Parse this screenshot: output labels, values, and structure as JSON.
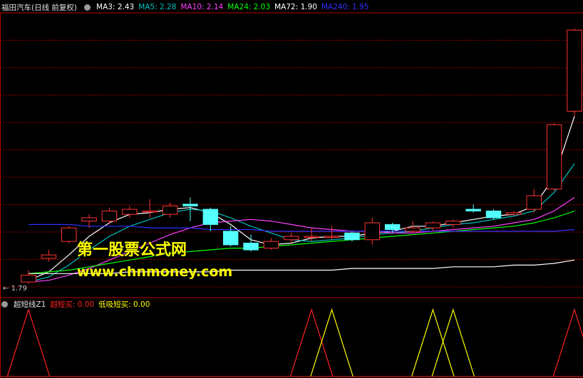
{
  "main_legend": {
    "title": "福田汽车(日线 前复权)",
    "items": [
      {
        "label": "MA3: 2.43",
        "color": "#ffffff"
      },
      {
        "label": "MA5: 2.28",
        "color": "#00bfbf"
      },
      {
        "label": "MA10: 2.14",
        "color": "#ff40ff"
      },
      {
        "label": "MA24: 2.03",
        "color": "#00ff00"
      },
      {
        "label": "MA72: 1.90",
        "color": "#ffffff"
      },
      {
        "label": "MA240: 1.95",
        "color": "#3030ff"
      }
    ]
  },
  "sub_legend": {
    "title": "超短线Z1",
    "items": [
      {
        "label": "超短买: 0.00",
        "color": "#ff2020"
      },
      {
        "label": "低吸短买: 0.00",
        "color": "#ffff00"
      }
    ]
  },
  "watermark": {
    "line1": "第一股票公式网",
    "line2": "www.chnmoney.com"
  },
  "low_marker": "1.79",
  "chart_data": {
    "type": "candlestick",
    "candles": [
      {
        "o": 1.8,
        "c": 1.84,
        "h": 1.87,
        "l": 1.79
      },
      {
        "o": 1.94,
        "c": 1.96,
        "h": 1.99,
        "l": 1.92
      },
      {
        "o": 2.04,
        "c": 2.12,
        "h": 2.13,
        "l": 2.03
      },
      {
        "o": 2.16,
        "c": 2.18,
        "h": 2.2,
        "l": 2.12
      },
      {
        "o": 2.16,
        "c": 2.22,
        "h": 2.24,
        "l": 2.14
      },
      {
        "o": 2.2,
        "c": 2.23,
        "h": 2.25,
        "l": 2.18
      },
      {
        "o": 2.22,
        "c": 2.22,
        "h": 2.29,
        "l": 2.18
      },
      {
        "o": 2.2,
        "c": 2.25,
        "h": 2.27,
        "l": 2.18
      },
      {
        "o": 2.26,
        "c": 2.25,
        "h": 2.3,
        "l": 2.16
      },
      {
        "o": 2.23,
        "c": 2.14,
        "h": 2.24,
        "l": 2.1
      },
      {
        "o": 2.1,
        "c": 2.02,
        "h": 2.13,
        "l": 2.01
      },
      {
        "o": 2.03,
        "c": 1.99,
        "h": 2.08,
        "l": 1.98
      },
      {
        "o": 2.0,
        "c": 2.04,
        "h": 2.06,
        "l": 1.99
      },
      {
        "o": 2.05,
        "c": 2.07,
        "h": 2.09,
        "l": 2.03
      },
      {
        "o": 2.07,
        "c": 2.07,
        "h": 2.12,
        "l": 2.04
      },
      {
        "o": 2.07,
        "c": 2.07,
        "h": 2.13,
        "l": 2.05
      },
      {
        "o": 2.09,
        "c": 2.05,
        "h": 2.1,
        "l": 2.04
      },
      {
        "o": 2.05,
        "c": 2.15,
        "h": 2.18,
        "l": 2.02
      },
      {
        "o": 2.14,
        "c": 2.11,
        "h": 2.15,
        "l": 2.09
      },
      {
        "o": 2.1,
        "c": 2.12,
        "h": 2.16,
        "l": 2.09
      },
      {
        "o": 2.12,
        "c": 2.15,
        "h": 2.16,
        "l": 2.1
      },
      {
        "o": 2.14,
        "c": 2.16,
        "h": 2.17,
        "l": 2.12
      },
      {
        "o": 2.23,
        "c": 2.22,
        "h": 2.26,
        "l": 2.21
      },
      {
        "o": 2.22,
        "c": 2.18,
        "h": 2.23,
        "l": 2.17
      },
      {
        "o": 2.2,
        "c": 2.21,
        "h": 2.22,
        "l": 2.19
      },
      {
        "o": 2.23,
        "c": 2.31,
        "h": 2.35,
        "l": 2.21
      },
      {
        "o": 2.35,
        "c": 2.73,
        "h": 2.74,
        "l": 2.34
      },
      {
        "o": 2.81,
        "c": 3.29,
        "h": 3.3,
        "l": 2.78
      }
    ],
    "ma": [
      {
        "name": "MA3",
        "color": "#ffffff",
        "values": [
          1.81,
          1.86,
          1.96,
          2.07,
          2.15,
          2.2,
          2.21,
          2.23,
          2.24,
          2.21,
          2.14,
          2.05,
          2.02,
          2.03,
          2.06,
          2.07,
          2.07,
          2.09,
          2.1,
          2.13,
          2.13,
          2.15,
          2.17,
          2.19,
          2.2,
          2.25,
          2.42,
          2.78
        ]
      },
      {
        "name": "MA5",
        "color": "#00bfbf",
        "values": [
          1.8,
          1.83,
          1.9,
          1.99,
          2.07,
          2.13,
          2.17,
          2.21,
          2.23,
          2.22,
          2.18,
          2.13,
          2.09,
          2.05,
          2.04,
          2.05,
          2.06,
          2.08,
          2.09,
          2.1,
          2.12,
          2.14,
          2.15,
          2.17,
          2.19,
          2.22,
          2.33,
          2.5
        ]
      },
      {
        "name": "MA10",
        "color": "#ff40ff",
        "values": [
          1.8,
          1.81,
          1.84,
          1.88,
          1.93,
          1.98,
          2.03,
          2.08,
          2.12,
          2.15,
          2.16,
          2.17,
          2.16,
          2.14,
          2.12,
          2.11,
          2.1,
          2.1,
          2.09,
          2.09,
          2.1,
          2.11,
          2.12,
          2.13,
          2.15,
          2.17,
          2.22,
          2.3
        ]
      },
      {
        "name": "MA24",
        "color": "#00ff00",
        "values": [
          1.85,
          1.86,
          1.87,
          1.89,
          1.91,
          1.93,
          1.95,
          1.97,
          1.98,
          1.99,
          2.0,
          2.0,
          2.01,
          2.02,
          2.03,
          2.04,
          2.05,
          2.06,
          2.07,
          2.08,
          2.09,
          2.1,
          2.11,
          2.12,
          2.13,
          2.15,
          2.18,
          2.22
        ]
      },
      {
        "name": "MA72",
        "color": "#ffffff",
        "values": [
          1.85,
          1.85,
          1.85,
          1.85,
          1.85,
          1.86,
          1.86,
          1.86,
          1.86,
          1.86,
          1.87,
          1.87,
          1.87,
          1.87,
          1.87,
          1.87,
          1.88,
          1.88,
          1.88,
          1.88,
          1.88,
          1.89,
          1.89,
          1.89,
          1.9,
          1.9,
          1.91,
          1.93
        ]
      },
      {
        "name": "MA240",
        "color": "#3030ff",
        "values": [
          2.14,
          2.14,
          2.14,
          2.13,
          2.13,
          2.13,
          2.12,
          2.12,
          2.12,
          2.11,
          2.11,
          2.11,
          2.1,
          2.1,
          2.1,
          2.1,
          2.1,
          2.1,
          2.1,
          2.1,
          2.1,
          2.1,
          2.1,
          2.1,
          2.1,
          2.1,
          2.1,
          2.11
        ]
      }
    ],
    "signals": {
      "super_short_buy": [
        1,
        0,
        0,
        0,
        0,
        0,
        0,
        0,
        0,
        0,
        0,
        0,
        0,
        0,
        1,
        0,
        0,
        0,
        0,
        0,
        0,
        0,
        0,
        0,
        0,
        0,
        0,
        1
      ],
      "low_buy": [
        0,
        0,
        0,
        0,
        0,
        0,
        0,
        0,
        0,
        0,
        0,
        0,
        0,
        0,
        0,
        1,
        0,
        0,
        0,
        0,
        1,
        1,
        0,
        0,
        0,
        0,
        0,
        0
      ]
    },
    "ylim": [
      1.75,
      3.35
    ],
    "grid": true
  }
}
